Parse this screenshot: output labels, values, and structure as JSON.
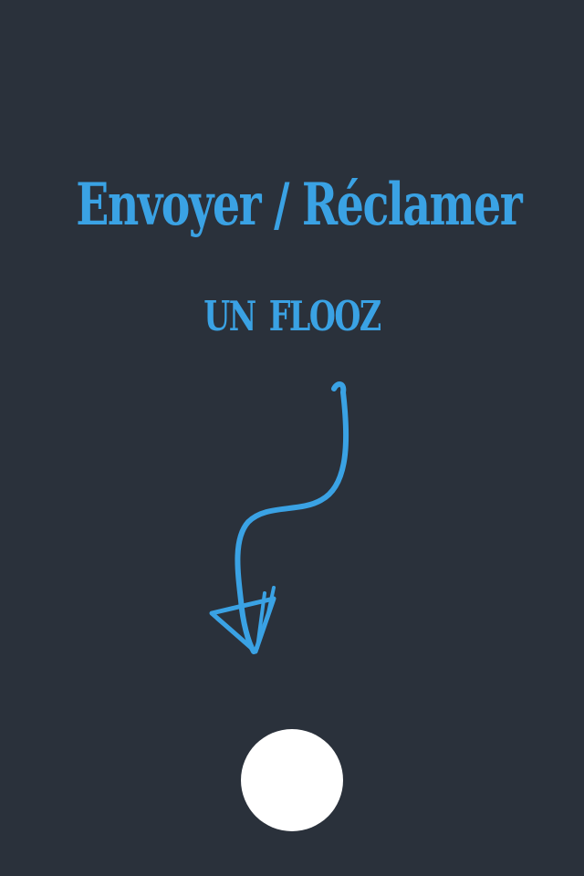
{
  "tutorial": {
    "line1": "Envoyer / Réclamer",
    "line2": "un flooz"
  },
  "icons": {
    "arrow": "hand-drawn-down-arrow-icon",
    "button": "circle-button"
  },
  "colors": {
    "background": "#2a313b",
    "accent": "#3aa2e4",
    "button": "#ffffff"
  }
}
